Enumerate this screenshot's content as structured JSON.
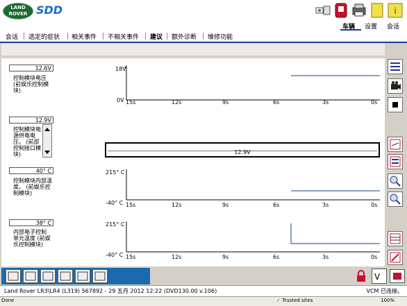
{
  "app": {
    "logo_line1": "LAND",
    "logo_line2": "ROVER",
    "product": "SDD"
  },
  "nav_top": {
    "items": [
      {
        "label": "车辆",
        "active": true
      },
      {
        "label": "设置",
        "active": false
      },
      {
        "label": "会话",
        "active": false
      }
    ]
  },
  "nav_tabs": {
    "items": [
      {
        "label": "会话",
        "active": false
      },
      {
        "label": "选定的症状",
        "active": false
      },
      {
        "label": "相关事件",
        "active": false
      },
      {
        "label": "不相关事件",
        "active": false
      },
      {
        "label": "建议",
        "active": true
      },
      {
        "label": "额外诊断",
        "active": false
      },
      {
        "label": "维修功能",
        "active": false
      }
    ]
  },
  "graphs": [
    {
      "value": "12.6V",
      "label": "控制模块电压 (前娱乐控制模块)",
      "y_max": "18V",
      "y_min": "0V",
      "x_ticks": [
        "15s",
        "12s",
        "9s",
        "6s",
        "3s",
        "0s"
      ]
    },
    {
      "value": "12.9V",
      "label": "控制模块电源供电电压。 (前部控制接口模块)",
      "highlight": "12.9V"
    },
    {
      "value": "40° C",
      "label": "控制模块内部温度。 (前娱乐控制模块)",
      "y_max": "215° C",
      "y_min": "-40° C",
      "x_ticks": [
        "15s",
        "12s",
        "9s",
        "6s",
        "3s",
        "0s"
      ]
    },
    {
      "value": "38° C",
      "label": "内部电子控制单元温度 (前娱乐控制模块)",
      "y_max": "215° C",
      "y_min": "-40° C",
      "x_ticks": [
        "15s",
        "12s",
        "9s",
        "6s",
        "3s",
        "0s"
      ]
    }
  ],
  "status": {
    "vehicle_info": "Land Rover LR3\\LR4 (L319) 567892 - 29 五月 2012 12:22 (DVD130.00 v.106)",
    "vcm": "VCM 已连接。"
  },
  "ie": {
    "left": "Done",
    "zone": "Trusted sites",
    "zoom": "100%"
  }
}
